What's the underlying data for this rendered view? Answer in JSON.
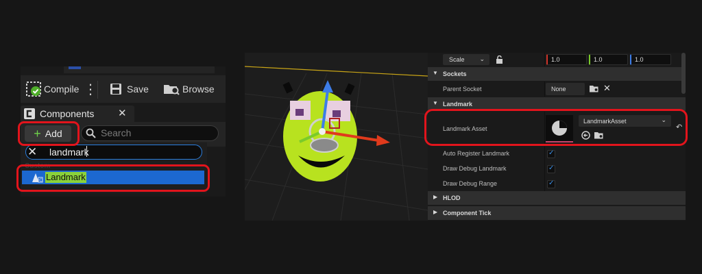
{
  "blueprint": {
    "toolbar": {
      "compile_label": "Compile",
      "save_label": "Save",
      "browse_label": "Browse"
    },
    "components_tab": {
      "title": "Components"
    },
    "add_label": "Add",
    "search_placeholder": "Search",
    "filter_value": "landmark",
    "section_label": "Custom",
    "result_label": "Landmark"
  },
  "details": {
    "scale_dropdown": "Scale",
    "scale_values": [
      "1.0",
      "1.0",
      "1.0"
    ],
    "sockets_category": "Sockets",
    "parent_socket_label": "Parent Socket",
    "parent_socket_value": "None",
    "landmark_category": "Landmark",
    "landmark_asset_label": "Landmark Asset",
    "landmark_asset_value": "LandmarkAsset",
    "auto_register_label": "Auto Register Landmark",
    "draw_debug_landmark_label": "Draw Debug Landmark",
    "draw_debug_range_label": "Draw Debug Range",
    "hlod_category": "HLOD",
    "component_tick_category": "Component Tick"
  },
  "colors": {
    "highlight_ring": "#e2141c",
    "selection": "#1c68d0",
    "search_match": "#8bd23a",
    "check_blue": "#3a8fe8",
    "axis_x": "#e03a1c",
    "axis_y": "#7acb2a",
    "axis_z": "#3d7de8",
    "creature_green": "#b8e21f"
  }
}
